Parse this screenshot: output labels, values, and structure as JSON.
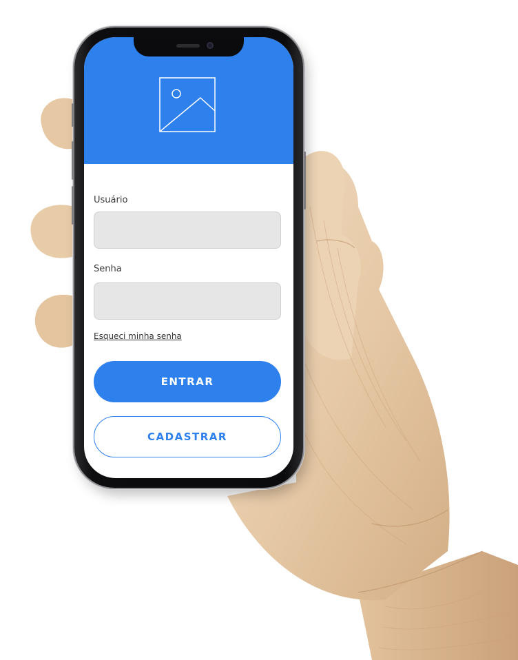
{
  "app": {
    "accent_color": "#2e80ec",
    "header_icon": "image-placeholder-icon"
  },
  "login_form": {
    "username_label": "Usuário",
    "username_value": "",
    "password_label": "Senha",
    "password_value": "",
    "forgot_password_link": "Esqueci minha senha",
    "login_button": "ENTRAR",
    "register_button": "CADASTRAR"
  }
}
